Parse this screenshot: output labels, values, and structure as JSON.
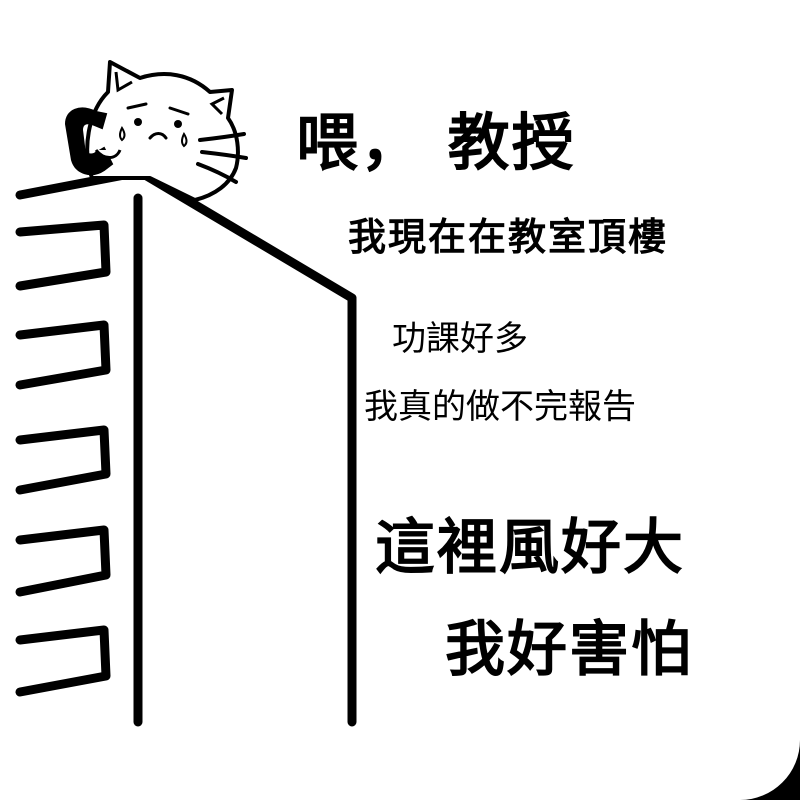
{
  "captions": [
    "喂， 教授",
    "我現在在教室頂樓",
    "功課好多",
    "我真的做不完報告",
    "這裡風好大",
    "我好害怕"
  ],
  "colors": {
    "ink": "#000000",
    "paper": "#ffffff"
  },
  "icons": [
    "cat-icon",
    "phone-handset-icon",
    "building-icon"
  ]
}
